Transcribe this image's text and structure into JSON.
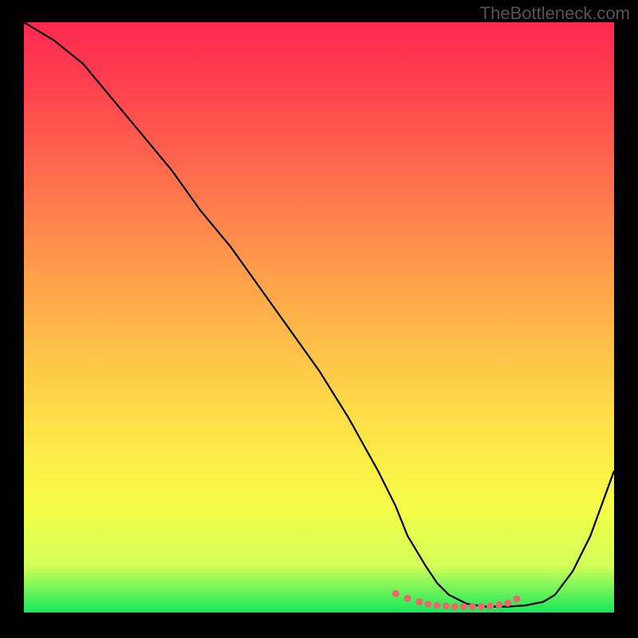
{
  "watermark": "TheBottleneck.com",
  "chart_data": {
    "type": "line",
    "title": "",
    "xlabel": "",
    "ylabel": "",
    "xlim": [
      0,
      100
    ],
    "ylim": [
      0,
      100
    ],
    "series": [
      {
        "name": "curve",
        "x": [
          0,
          5,
          10,
          15,
          20,
          25,
          30,
          35,
          40,
          45,
          50,
          55,
          60,
          63,
          65,
          68,
          70,
          72,
          75,
          78,
          80,
          82,
          85,
          88,
          90,
          93,
          96,
          100
        ],
        "values": [
          100,
          97,
          93,
          87,
          81,
          75,
          68,
          62,
          55,
          48,
          41,
          33,
          24,
          18,
          13,
          8,
          5,
          3,
          1.5,
          1,
          1,
          1,
          1.2,
          1.8,
          3,
          7,
          13,
          24
        ]
      },
      {
        "name": "highlight-dots",
        "x": [
          63,
          65,
          67,
          68.5,
          70,
          71.5,
          73,
          74.5,
          76,
          77.5,
          79,
          80.5,
          82,
          83.5
        ],
        "values": [
          3.2,
          2.4,
          1.8,
          1.4,
          1.2,
          1.1,
          1.0,
          1.0,
          1.0,
          1.0,
          1.1,
          1.3,
          1.6,
          2.3
        ]
      }
    ],
    "colors": {
      "curve": "#000000",
      "dots": "#e86a6a",
      "background_top": "#ff2850",
      "background_bottom": "#16e85a"
    }
  }
}
